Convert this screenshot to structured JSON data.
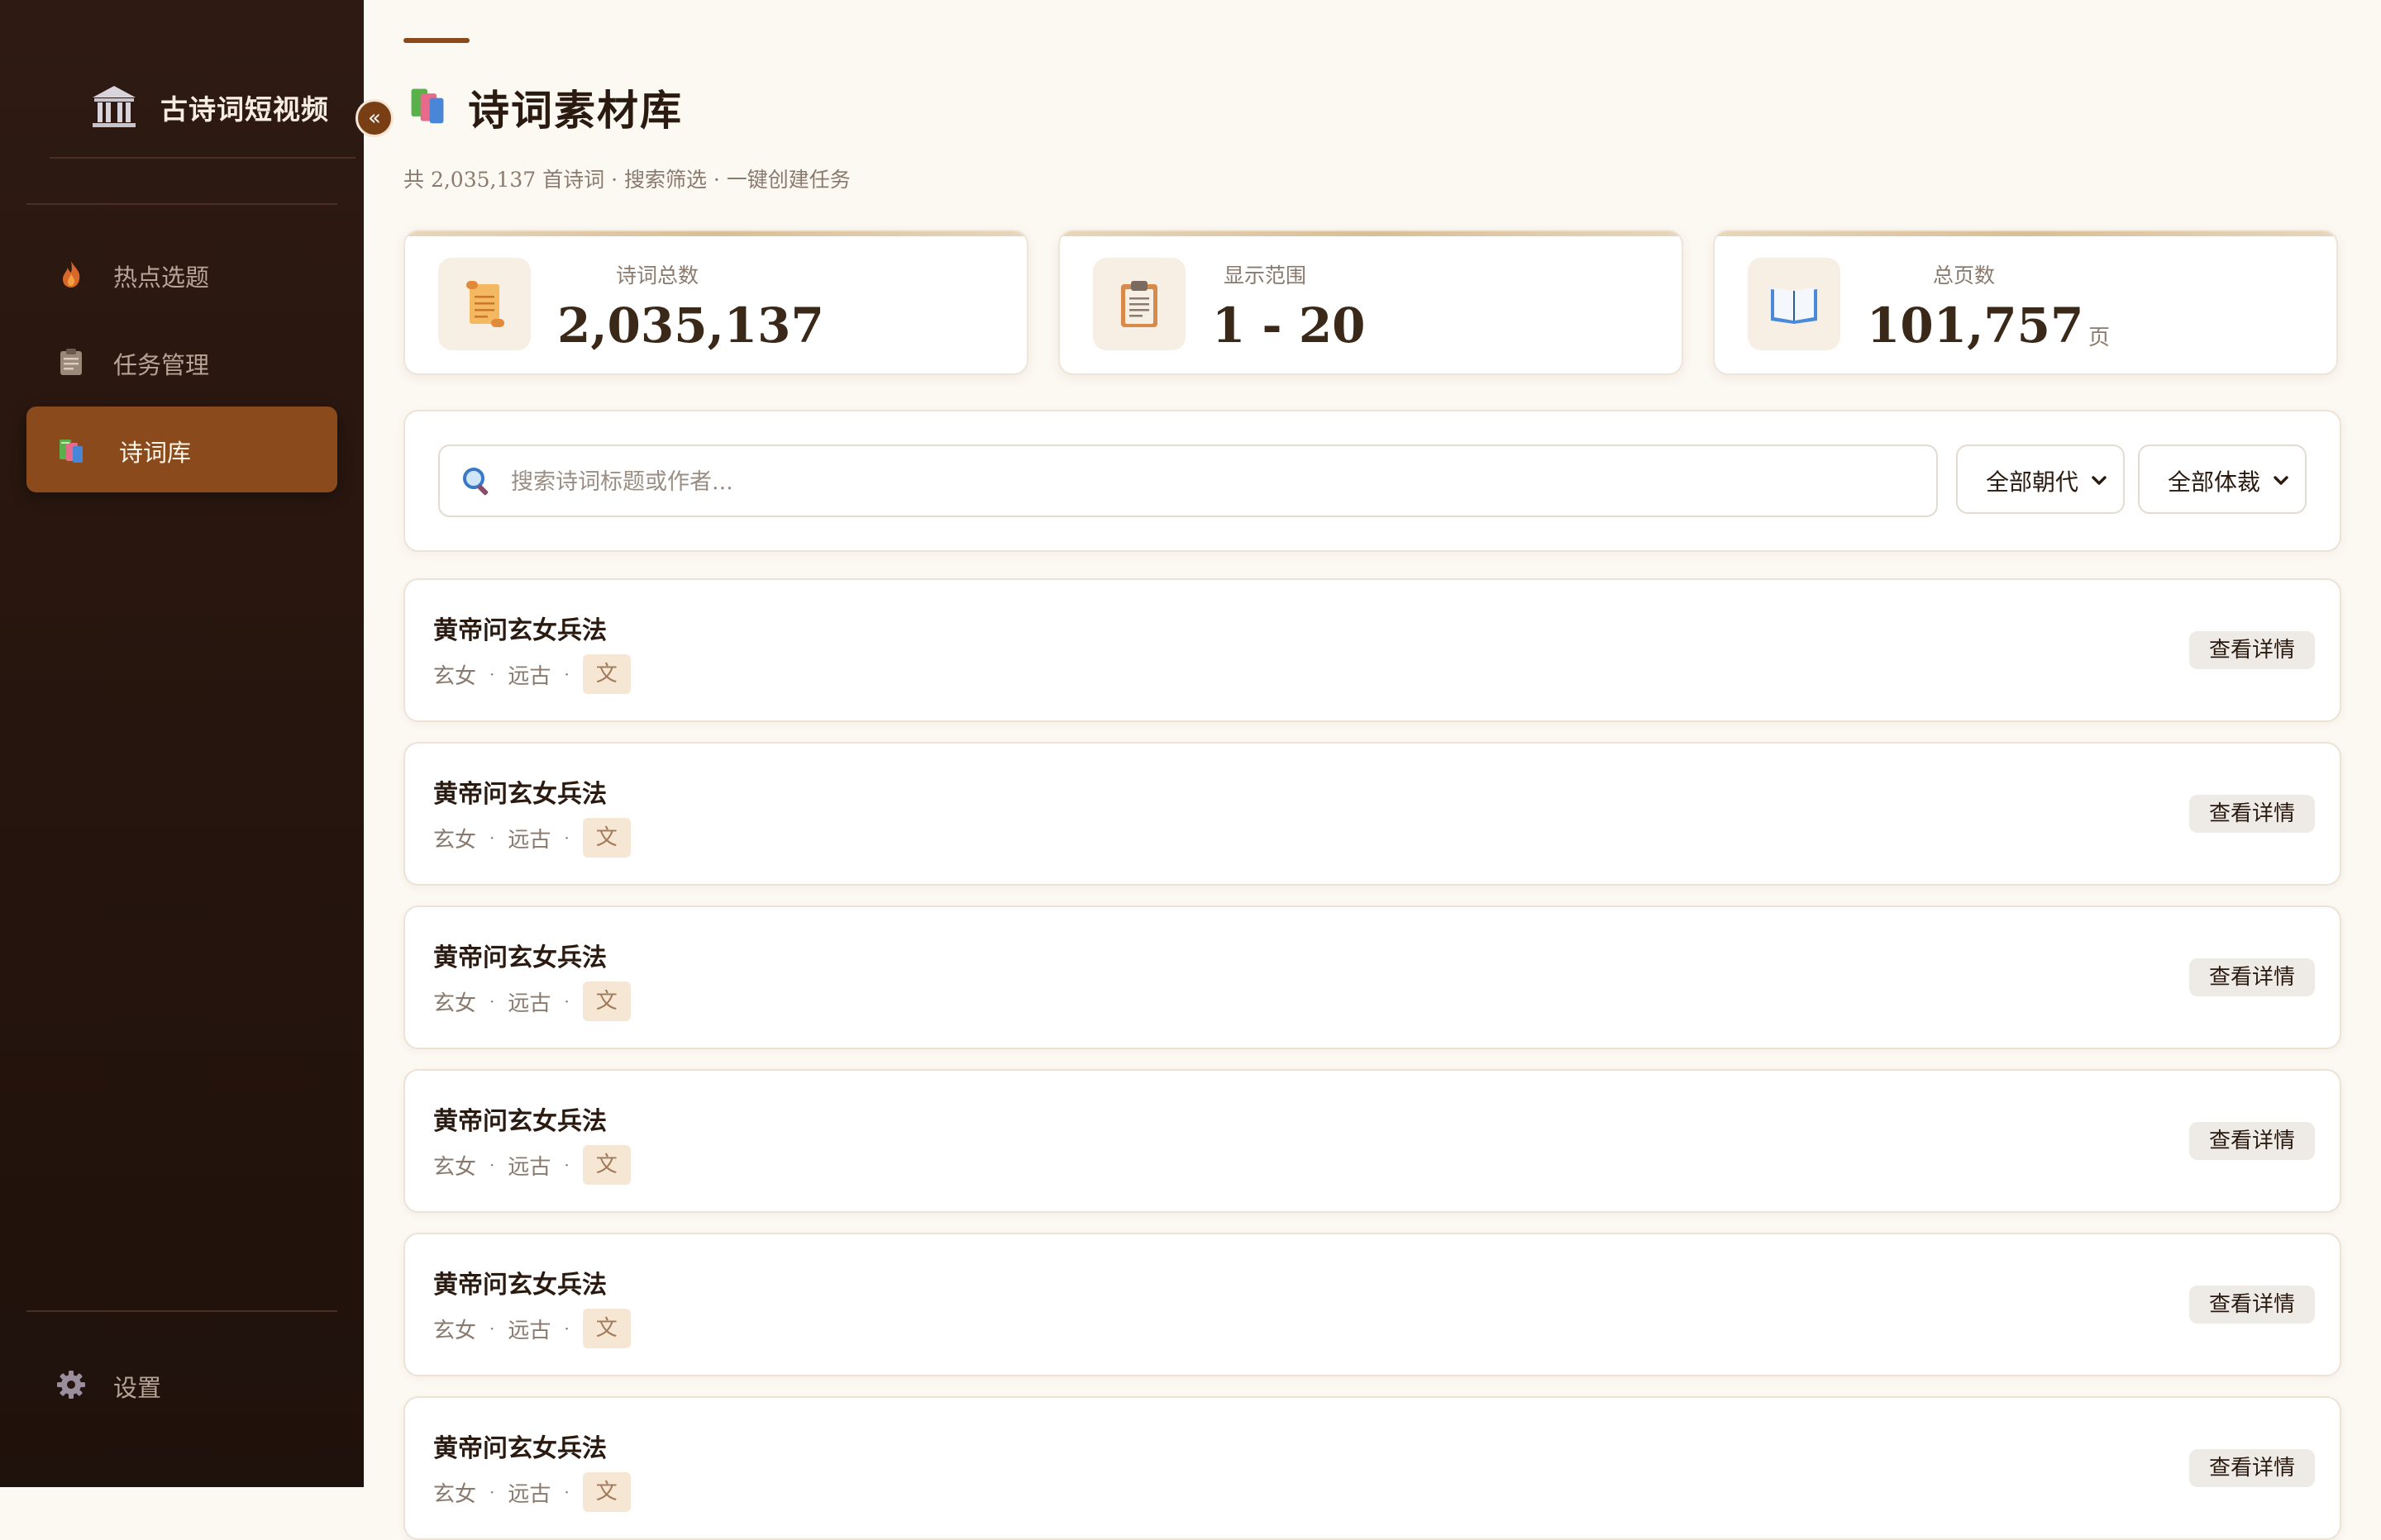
{
  "app": {
    "name": "古诗词短视频"
  },
  "sidebar": {
    "items": [
      {
        "label": "热点选题",
        "icon": "fire-icon",
        "active": false
      },
      {
        "label": "任务管理",
        "icon": "clipboard-icon",
        "active": false
      },
      {
        "label": "诗词库",
        "icon": "books-icon",
        "active": true
      }
    ],
    "settings_label": "设置",
    "collapse_glyph": "«"
  },
  "page": {
    "title": "诗词素材库",
    "subtitle": "共 2,035,137 首诗词 · 搜索筛选 · 一键创建任务"
  },
  "stats": [
    {
      "label": "诗词总数",
      "value": "2,035,137",
      "unit": "",
      "icon": "scroll-icon"
    },
    {
      "label": "显示范围",
      "value": "1 - 20",
      "unit": "",
      "icon": "clipboard-icon"
    },
    {
      "label": "总页数",
      "value": "101,757",
      "unit": "页",
      "icon": "open-book-icon"
    }
  ],
  "search": {
    "placeholder": "搜索诗词标题或作者...",
    "dynasty_selected": "全部朝代",
    "genre_selected": "全部体裁"
  },
  "poems": [
    {
      "title": "黄帝问玄女兵法",
      "author": "玄女",
      "dynasty": "远古",
      "genre": "文",
      "action": "查看详情"
    },
    {
      "title": "黄帝问玄女兵法",
      "author": "玄女",
      "dynasty": "远古",
      "genre": "文",
      "action": "查看详情"
    },
    {
      "title": "黄帝问玄女兵法",
      "author": "玄女",
      "dynasty": "远古",
      "genre": "文",
      "action": "查看详情"
    },
    {
      "title": "黄帝问玄女兵法",
      "author": "玄女",
      "dynasty": "远古",
      "genre": "文",
      "action": "查看详情"
    },
    {
      "title": "黄帝问玄女兵法",
      "author": "玄女",
      "dynasty": "远古",
      "genre": "文",
      "action": "查看详情"
    },
    {
      "title": "黄帝问玄女兵法",
      "author": "玄女",
      "dynasty": "远古",
      "genre": "文",
      "action": "查看详情"
    }
  ],
  "colors": {
    "sidebar_bg": "#26150e",
    "accent": "#8a4a1c",
    "page_bg": "#fcf8f2"
  }
}
